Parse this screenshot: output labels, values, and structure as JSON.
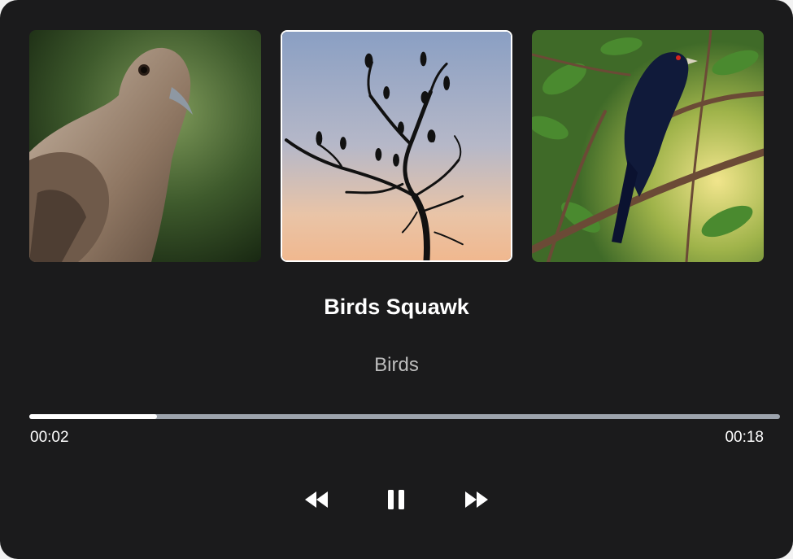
{
  "player": {
    "title": "Birds Squawk",
    "artist": "Birds",
    "current_time": "00:02",
    "duration": "00:18",
    "progress_fraction": 0.17,
    "selected_index": 1
  },
  "controls": {
    "rewind": "rewind-icon",
    "pause": "pause-icon",
    "forward": "fast-forward-icon"
  },
  "artwork": [
    {
      "subject": "dove-portrait"
    },
    {
      "subject": "birds-silhouette-tree"
    },
    {
      "subject": "black-bird-on-branch"
    }
  ],
  "colors": {
    "background": "#1b1b1c",
    "progress_fill": "#ffffff",
    "progress_track": "#9da4ad",
    "text": "#ffffff",
    "subtext": "#bdbdbd"
  }
}
